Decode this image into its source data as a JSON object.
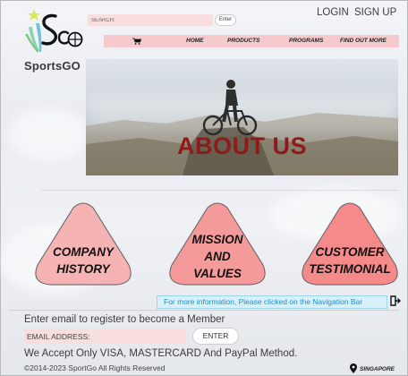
{
  "brand": {
    "name": "SportsGO"
  },
  "header": {
    "search_placeholder": "SEARCH:",
    "search_button": "Enter",
    "login": "LOGIN",
    "signup": "SIGN UP"
  },
  "nav": {
    "cart_icon": "shopping-cart-icon",
    "items": [
      "HOME",
      "PRODUCTS",
      "PROGRAMS",
      "FIND OUT MORE"
    ]
  },
  "hero": {
    "title": "ABOUT US"
  },
  "sections": [
    {
      "line1": "COMPANY",
      "line2": "HISTORY",
      "line3": "",
      "color": "#f5b3b3"
    },
    {
      "line1": "MISSION",
      "line2": "AND",
      "line3": "VALUES",
      "color": "#f59a9a"
    },
    {
      "line1": "CUSTOMER",
      "line2": "TESTIMONIAL",
      "line3": "",
      "color": "#f58a8a"
    }
  ],
  "info": {
    "text": "For more information, Please clicked on the Navigation Bar"
  },
  "footer": {
    "register_label": "Enter email to register to become a Member",
    "email_placeholder": "EMAIL ADDRESS:",
    "enter_button": "ENTER",
    "payment_text": "We Accept Only VISA, MASTERCARD And PayPal Method.",
    "copyright": "©2014-2023 SportGo All Rights Reserved",
    "location": "SINGAPORE"
  },
  "colors": {
    "accent": "#8e1a1a",
    "nav_bg": "#f6c9cd",
    "input_bg": "#f8dede",
    "info_text": "#1e8fc0"
  }
}
